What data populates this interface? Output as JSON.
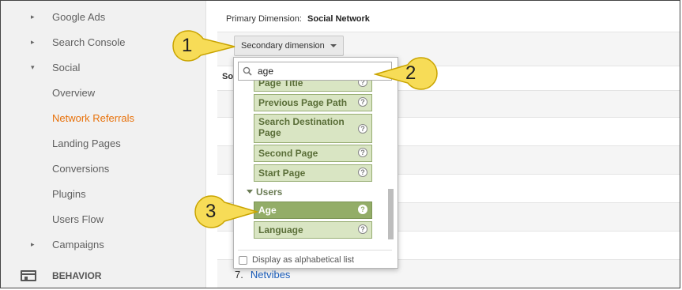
{
  "sidebar": {
    "items": [
      {
        "label": "Google Ads",
        "arrow": "▸"
      },
      {
        "label": "Search Console",
        "arrow": "▸"
      },
      {
        "label": "Social",
        "arrow": "▾"
      },
      {
        "label": "Overview"
      },
      {
        "label": "Network Referrals",
        "active": true
      },
      {
        "label": "Landing Pages"
      },
      {
        "label": "Conversions"
      },
      {
        "label": "Plugins"
      },
      {
        "label": "Users Flow"
      },
      {
        "label": "Campaigns",
        "arrow": "▸"
      },
      {
        "label": "BEHAVIOR",
        "icon": "behavior-icon"
      }
    ]
  },
  "report": {
    "primary_label": "Primary Dimension:",
    "primary_value": "Social Network",
    "secondary_button": "Secondary dimension",
    "column_header_partial": "So",
    "row7_index": "7.",
    "row7_link": "Netvibes"
  },
  "dropdown": {
    "search_value": "age",
    "items": [
      {
        "label": "Page Title",
        "help": "?"
      },
      {
        "label": "Previous Page Path",
        "help": "?"
      },
      {
        "label": "Search Destination Page",
        "help": "?"
      },
      {
        "label": "Second Page",
        "help": "?"
      },
      {
        "label": "Start Page",
        "help": "?"
      }
    ],
    "group_label": "Users",
    "group_items": [
      {
        "label": "Age",
        "help": "?",
        "selected": true
      },
      {
        "label": "Language",
        "help": "?"
      }
    ],
    "alphabetical_label": "Display as alphabetical list"
  },
  "callouts": [
    "1",
    "2",
    "3"
  ],
  "colors": {
    "accent_active": "#e8710a",
    "item_bg": "#d9e5c3",
    "item_selected_bg": "#93ad68",
    "callout_yellow": "#f7dc57",
    "link": "#1a5dbb"
  }
}
